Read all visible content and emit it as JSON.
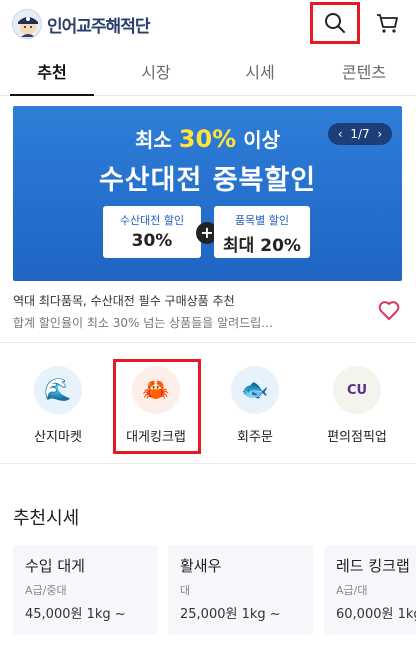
{
  "header": {
    "brand": "인어교주해적단",
    "search_icon": "search-icon",
    "cart_icon": "cart-icon"
  },
  "tabs": [
    {
      "label": "추천",
      "active": true
    },
    {
      "label": "시장",
      "active": false
    },
    {
      "label": "시세",
      "active": false
    },
    {
      "label": "콘텐츠",
      "active": false
    }
  ],
  "banner": {
    "line1_prefix": "최소",
    "line1_pct": "30%",
    "line1_suffix": "이상",
    "line2": "수산대전 중복할인",
    "pager": {
      "current": "1/7",
      "prev": "‹",
      "next": "›"
    },
    "coupon1": {
      "label": "수산대전 할인",
      "value": "30%"
    },
    "coupon2": {
      "label": "품목별 할인",
      "value": "최대 20%"
    },
    "plus": "+"
  },
  "promo": {
    "title": "역대 최다품목, 수산대전 필수 구매상품 추천",
    "subtitle": "합계 할인율이 최소 30% 넘는 상품들을 알려드립..."
  },
  "categories": [
    {
      "label": "산지마켓",
      "icon": "wave-icon",
      "glyph": "🌊"
    },
    {
      "label": "대게킹크랩",
      "icon": "crab-icon",
      "glyph": "🦀"
    },
    {
      "label": "회주문",
      "icon": "fish-icon",
      "glyph": "🐟"
    },
    {
      "label": "편의점픽업",
      "icon": "cu-store-icon",
      "glyph": "CU"
    }
  ],
  "prices": {
    "title": "추천시세",
    "items": [
      {
        "name": "수입 대게",
        "grade": "A급/중대",
        "price": "45,000원 1kg ~"
      },
      {
        "name": "활새우",
        "grade": "대",
        "price": "25,000원 1kg ~"
      },
      {
        "name": "레드 킹크랩",
        "grade": "A급/대",
        "price": "60,000원 1kg ~"
      }
    ]
  },
  "colors": {
    "accent_red": "#e41b23",
    "banner_blue": "#1f65c4",
    "highlight_yellow": "#ffe23b"
  }
}
